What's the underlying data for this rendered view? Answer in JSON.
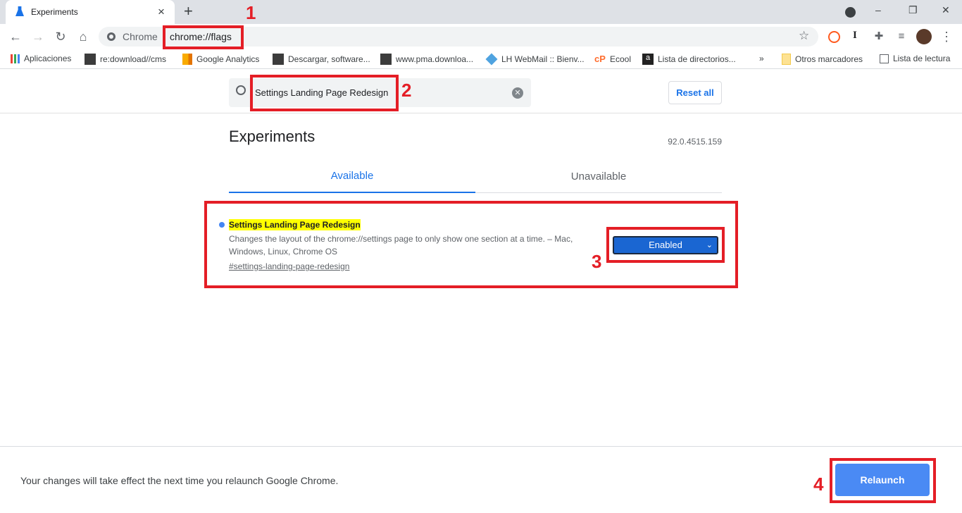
{
  "tab": {
    "title": "Experiments",
    "close": "×",
    "new_tab": "+"
  },
  "window": {
    "minimize": "–",
    "restore": "❐",
    "close": "✕"
  },
  "omnibox": {
    "chip": "Chrome",
    "url": "chrome://flags"
  },
  "bookmarks": [
    {
      "label": "Aplicaciones",
      "icon": "apps-grid-icon",
      "color": "#4285f4"
    },
    {
      "label": "re:download//cms",
      "icon": "download-site-icon",
      "color": "#3c3c3c"
    },
    {
      "label": "Google Analytics",
      "icon": "analytics-icon",
      "color": "#f9ab00"
    },
    {
      "label": "Descargar, software...",
      "icon": "download-site-icon",
      "color": "#3c3c3c"
    },
    {
      "label": "www.pma.downloa...",
      "icon": "download-site-icon",
      "color": "#3c3c3c"
    },
    {
      "label": "LH WebMail :: Bienv...",
      "icon": "webmail-icon",
      "color": "#4fa3e0"
    },
    {
      "label": "Ecool",
      "icon": "cpanel-icon",
      "color": "#ff6c2c"
    },
    {
      "label": "Lista de directorios...",
      "icon": "a-icon",
      "color": "#222222"
    }
  ],
  "bookmarks_more": "»",
  "other_bookmarks": "Otros marcadores",
  "reading_list": "Lista de lectura",
  "search": {
    "value": "Settings Landing Page Redesign"
  },
  "reset_all": "Reset all",
  "page_title": "Experiments",
  "version": "92.0.4515.159",
  "tabs": [
    {
      "label": "Available",
      "active": true
    },
    {
      "label": "Unavailable",
      "active": false
    }
  ],
  "experiment": {
    "name": "Settings Landing Page Redesign",
    "description_line1": "Changes the layout of the chrome://settings page to only show one section at a time. – Mac,",
    "description_line2": "Windows, Linux, Chrome OS",
    "link": "#settings-landing-page-redesign",
    "state": "Enabled"
  },
  "footer": {
    "message": "Your changes will take effect the next time you relaunch Google Chrome.",
    "relaunch": "Relaunch"
  },
  "annotations": [
    "1",
    "2",
    "3",
    "4"
  ],
  "colors": {
    "accent": "#1a73e8",
    "annotation": "#e41e26",
    "highlight": "#ffff00",
    "select": "#1a66d2"
  }
}
